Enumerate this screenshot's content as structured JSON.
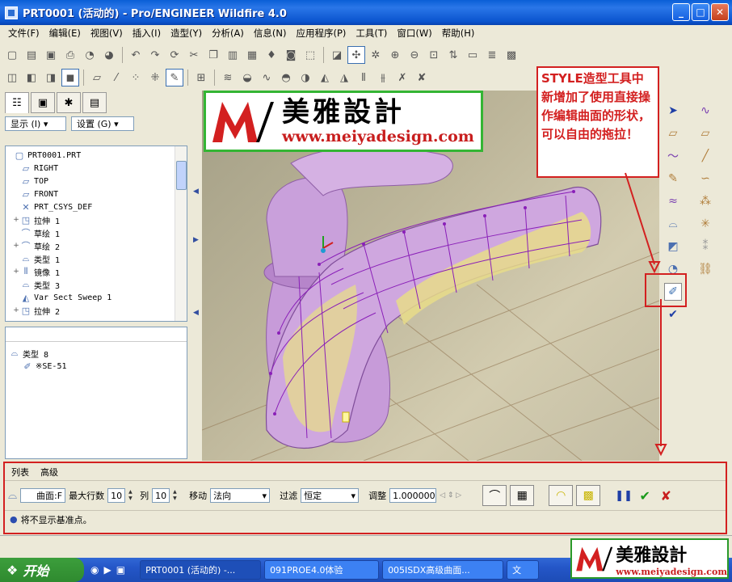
{
  "window": {
    "title": "PRT0001 (活动的) - Pro/ENGINEER Wildfire 4.0",
    "buttons": [
      "_",
      "□",
      "✕"
    ]
  },
  "menu": [
    "文件(F)",
    "编辑(E)",
    "视图(V)",
    "插入(I)",
    "造型(Y)",
    "分析(A)",
    "信息(N)",
    "应用程序(P)",
    "工具(T)",
    "窗口(W)",
    "帮助(H)"
  ],
  "left_panel": {
    "show_button": "显示 (I) ▾",
    "settings_button": "设置 (G) ▾",
    "tree_items": [
      {
        "label": "PRT0001.PRT",
        "expand": "",
        "icon": "part-icon"
      },
      {
        "label": "RIGHT",
        "expand": "",
        "icon": "datum-plane-icon"
      },
      {
        "label": "TOP",
        "expand": "",
        "icon": "datum-plane-icon"
      },
      {
        "label": "FRONT",
        "expand": "",
        "icon": "datum-plane-icon"
      },
      {
        "label": "PRT_CSYS_DEF",
        "expand": "",
        "icon": "csys-icon"
      },
      {
        "label": "拉伸 1",
        "expand": "+",
        "icon": "extrude-icon"
      },
      {
        "label": "草绘 1",
        "expand": "",
        "icon": "sketch-icon"
      },
      {
        "label": "草绘 2",
        "expand": "+",
        "icon": "sketch-icon"
      },
      {
        "label": "类型 1",
        "expand": "",
        "icon": "style-icon"
      },
      {
        "label": "镜像 1",
        "expand": "+",
        "icon": "mirror-icon"
      },
      {
        "label": "类型 3",
        "expand": "",
        "icon": "style-icon"
      },
      {
        "label": "Var Sect Sweep 1",
        "expand": "",
        "icon": "sweep-icon"
      },
      {
        "label": "拉伸 2",
        "expand": "+",
        "icon": "extrude-icon"
      }
    ],
    "style_tree": {
      "root": "类型 8",
      "child": "※SE-51"
    }
  },
  "logo": {
    "brand": "美雅設計",
    "url": "www.meiyadesign.com"
  },
  "callout": {
    "text": "STYLE造型工具中新增加了使用直接操作编辑曲面的形状，可以自由的拖拉！"
  },
  "dashboard": {
    "tabs": [
      "列表",
      "高级"
    ],
    "surface_field": "曲面:F",
    "max_rows_label": "最大行数",
    "max_rows_value": "10",
    "cols_label": "列",
    "cols_value": "10",
    "move_label": "移动",
    "move_value": "法向",
    "filter_label": "过滤",
    "filter_value": "恒定",
    "adjust_label": "调整",
    "adjust_value": "1.000000",
    "message": "将不显示基准点。"
  },
  "taskbar": {
    "start": "开始",
    "tasks": [
      "PRT0001 (活动的) -...",
      "091PROE4.0体验",
      "005ISDX高级曲面..."
    ],
    "last_task": "文"
  },
  "colors": {
    "callout": "#d32020",
    "logo_border": "#34b534",
    "surface_purple": "#b78ccf",
    "highlight_yellow": "#e7dc8a"
  }
}
